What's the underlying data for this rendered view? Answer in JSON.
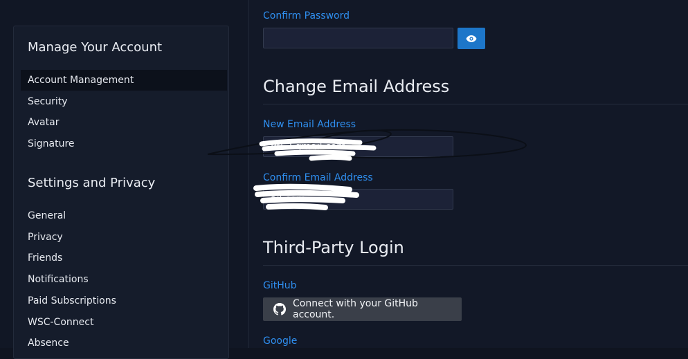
{
  "sidebar": {
    "account_heading": "Manage Your Account",
    "account_items": [
      {
        "label": "Account Management",
        "active": true
      },
      {
        "label": "Security"
      },
      {
        "label": "Avatar"
      },
      {
        "label": "Signature"
      }
    ],
    "privacy_heading": "Settings and Privacy",
    "privacy_items": [
      {
        "label": "General"
      },
      {
        "label": "Privacy"
      },
      {
        "label": "Friends"
      },
      {
        "label": "Notifications"
      },
      {
        "label": "Paid Subscriptions"
      },
      {
        "label": "WSC-Connect"
      },
      {
        "label": "Absence"
      }
    ]
  },
  "password": {
    "confirm_label": "Confirm Password",
    "confirm_value": "",
    "toggle_icon": "eye-icon"
  },
  "email": {
    "section_title": "Change Email Address",
    "new_label": "New Email Address",
    "new_value": "Pri      2   gmail.com",
    "confirm_label": "Confirm Email Address",
    "confirm_value": "              ail.com"
  },
  "third_party": {
    "section_title": "Third-Party Login",
    "github_label": "GitHub",
    "github_button": "Connect with your GitHub account.",
    "google_label": "Google"
  },
  "colors": {
    "accent": "#2f8ff0",
    "button_blue": "#1d76c9",
    "background": "#121827"
  }
}
